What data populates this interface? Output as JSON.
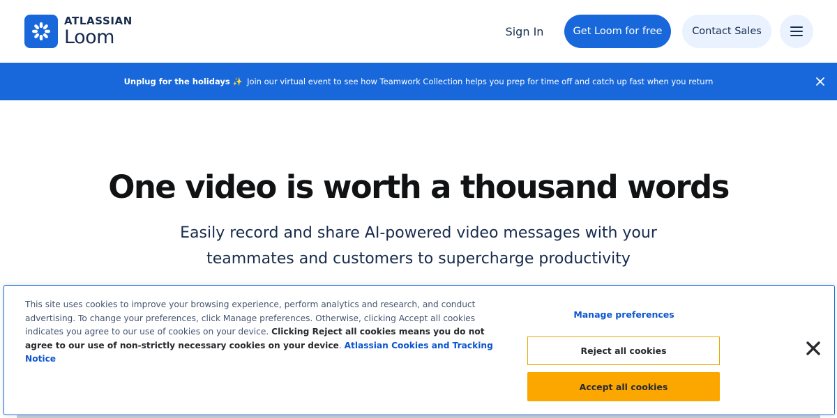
{
  "colors": {
    "brand_blue": "#1868db",
    "light_blue": "#e9f2fe",
    "accept_orange": "#fca700",
    "link_blue": "#0c55cf"
  },
  "header": {
    "logo_brand": "ATLASSIAN",
    "logo_product": "Loom",
    "logo_icon": "loom-burst-icon",
    "sign_in": "Sign In",
    "get_free": "Get Loom for free",
    "contact_sales": "Contact Sales",
    "menu_icon": "hamburger-menu-icon"
  },
  "banner": {
    "bold": "Unplug for the holidays",
    "sparkle": "✨",
    "text": "Join our virtual event to see how Teamwork Collection helps you prep for time off and catch up fast when you return",
    "close_icon": "close-icon"
  },
  "hero": {
    "title": "One video is worth a thousand words",
    "subtitle": "Easily record and share AI-powered video messages with your teammates and customers to supercharge productivity"
  },
  "cookie": {
    "text_part1": "This site uses cookies to improve your browsing experience, perform analytics and research, and conduct advertising. To change your preferences, click Manage preferences. Otherwise, clicking Accept all cookies indicates you agree to our use of cookies on your device. ",
    "text_bold": "Clicking Reject all cookies means you do not agree to our use of non-strictly necessary cookies on your device",
    "text_period": ".",
    "link": "Atlassian Cookies and Tracking Notice",
    "manage": "Manage preferences",
    "reject": "Reject all cookies",
    "accept": "Accept all cookies",
    "close_icon": "close-icon"
  }
}
